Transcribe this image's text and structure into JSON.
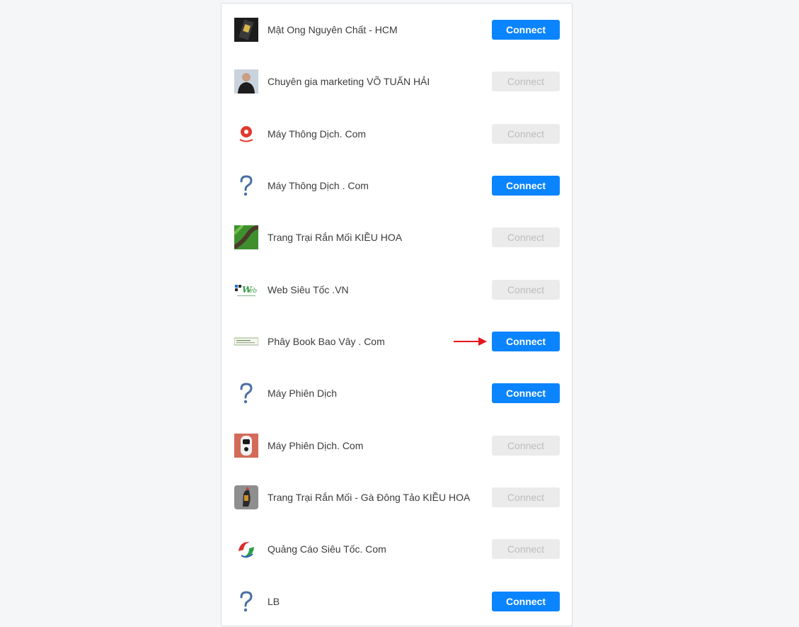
{
  "pages": [
    {
      "name": "Mật Ong Nguyên Chất - HCM",
      "button_label": "Connect",
      "enabled": true,
      "avatar_icon": "honey-jar-photo-icon"
    },
    {
      "name": "Chuyên gia marketing VÕ TUẤN HẢI",
      "button_label": "Connect",
      "enabled": false,
      "avatar_icon": "person-photo-icon"
    },
    {
      "name": "Máy Thông Dịch. Com",
      "button_label": "Connect",
      "enabled": false,
      "avatar_icon": "globe-pin-logo-icon"
    },
    {
      "name": "Máy Thông Dịch . Com",
      "button_label": "Connect",
      "enabled": true,
      "avatar_icon": "question-mark-icon"
    },
    {
      "name": "Trang Trại Rắn Mối KIỀU HOA",
      "button_label": "Connect",
      "enabled": false,
      "avatar_icon": "lizard-photo-icon"
    },
    {
      "name": "Web Siêu Tốc .VN",
      "button_label": "Connect",
      "enabled": false,
      "avatar_icon": "web-logo-icon"
    },
    {
      "name": "Phây Book Bao Vây . Com",
      "button_label": "Connect",
      "enabled": true,
      "avatar_icon": "banner-logo-icon"
    },
    {
      "name": "Máy Phiên Dịch",
      "button_label": "Connect",
      "enabled": true,
      "avatar_icon": "question-mark-icon"
    },
    {
      "name": "Máy Phiên Dịch. Com",
      "button_label": "Connect",
      "enabled": false,
      "avatar_icon": "translator-device-photo-icon"
    },
    {
      "name": "Trang Trại Rắn Mối - Gà Đông Tảo KIỀU HOA",
      "button_label": "Connect",
      "enabled": false,
      "avatar_icon": "rooster-photo-icon"
    },
    {
      "name": "Quảng Cáo Siêu Tốc. Com",
      "button_label": "Connect",
      "enabled": false,
      "avatar_icon": "swirl-logo-icon"
    },
    {
      "name": "LB",
      "button_label": "Connect",
      "enabled": true,
      "avatar_icon": "question-mark-icon"
    }
  ],
  "colors": {
    "accent": "#0a84ff",
    "disabled_bg": "#ebebeb",
    "disabled_text": "#bdbdbd",
    "arrow": "#e8141b"
  },
  "annotation": {
    "icon": "red-arrow-icon",
    "points_to_row": 7
  }
}
